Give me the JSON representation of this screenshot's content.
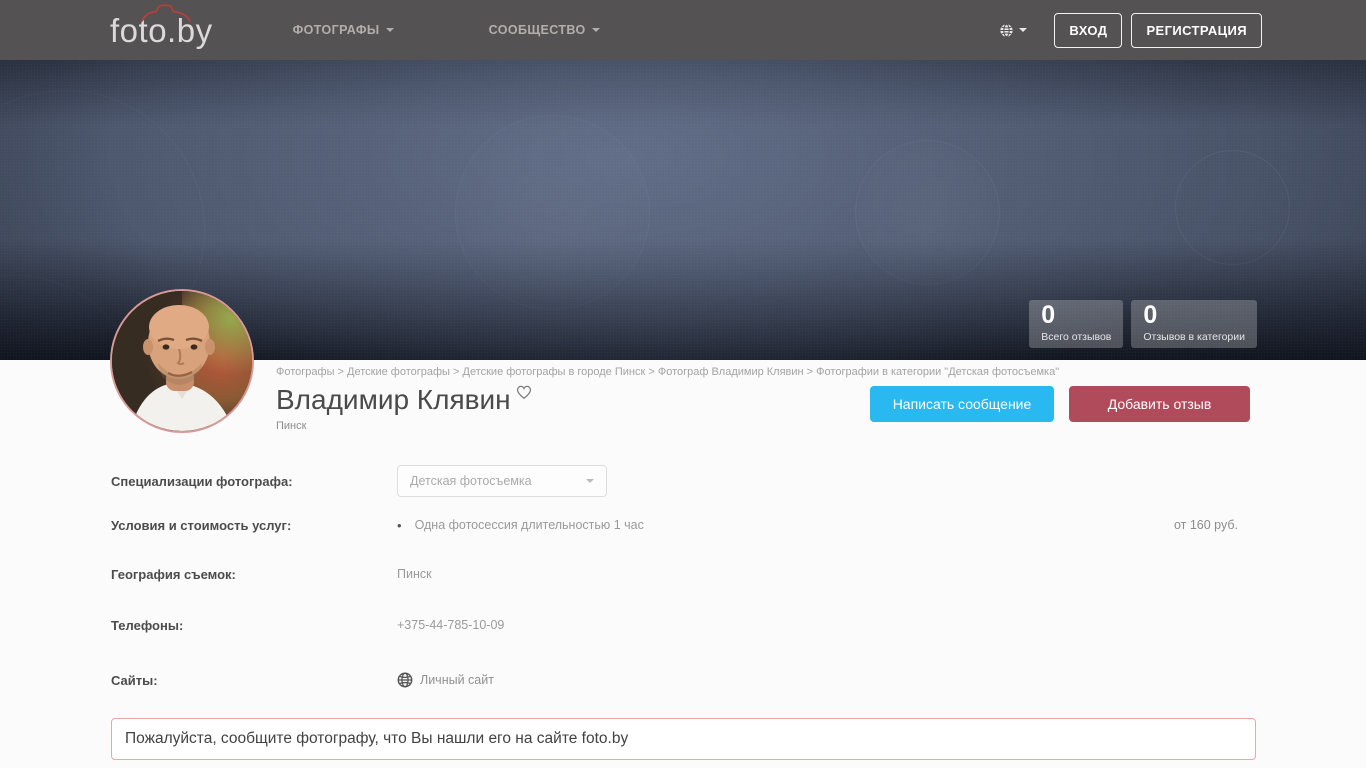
{
  "brand": {
    "name": "foto.by"
  },
  "nav": {
    "items": [
      {
        "label": "ФОТОГРАФЫ"
      },
      {
        "label": "СООБЩЕСТВО"
      }
    ]
  },
  "auth": {
    "login_label": "ВХОД",
    "register_label": "РЕГИСТРАЦИЯ"
  },
  "stats": [
    {
      "value": "0",
      "label": "Всего отзывов"
    },
    {
      "value": "0",
      "label": "Отзывов в категории"
    }
  ],
  "breadcrumb": {
    "items": [
      "Фотографы",
      "Детские фотографы",
      "Детские фотографы в городе Пинск",
      "Фотограф Владимир Клявин",
      "Фотографии в категории \"Детская фотосъемка\""
    ]
  },
  "profile": {
    "name": "Владимир Клявин",
    "city": "Пинск",
    "message_button": "Написать сообщение",
    "review_button": "Добавить отзыв"
  },
  "details": {
    "specializations": {
      "label": "Специализации фотографа:",
      "selected": "Детская фотосъемка"
    },
    "pricing": {
      "label": "Условия и стоимость услуг:",
      "item": "Одна фотосессия длительностью 1 час",
      "price": "от 160 руб."
    },
    "geography": {
      "label": "География съемок:",
      "value": "Пинск"
    },
    "phones": {
      "label": "Телефоны:",
      "value": "+375-44-785-10-09"
    },
    "sites": {
      "label": "Сайты:",
      "link": "Личный сайт"
    }
  },
  "notice_text": "Пожалуйста, сообщите фотографу, что Вы нашли его на сайте foto.by",
  "colors": {
    "navbar": "#545252",
    "hero_base": "#4a5469",
    "accent_blue": "#29b8f0",
    "accent_red": "#b04b5c",
    "notice_border": "#eba6a6",
    "logo_camera": "#b5413c"
  }
}
